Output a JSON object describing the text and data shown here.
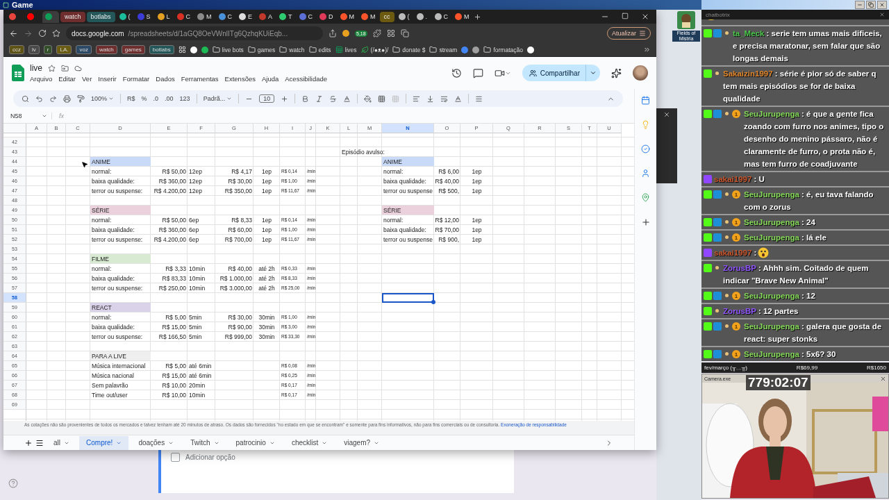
{
  "window": {
    "title": "Game"
  },
  "desktop_icon": {
    "label": "Fields of Mistria"
  },
  "browser": {
    "tabs": [
      {
        "kind": "icon",
        "color": "#e8453c",
        "selected": false
      },
      {
        "kind": "icon",
        "color": "#ff0000",
        "selected": false
      },
      {
        "kind": "icon",
        "color": "#0f9d58",
        "selected": true
      },
      {
        "kind": "group",
        "label": "watch",
        "color": "#6e2e2e",
        "selected": false
      },
      {
        "kind": "group",
        "label": "botlabs",
        "color": "#24575a",
        "selected": false
      },
      {
        "kind": "tab",
        "label": "(",
        "color": "#1abc9c",
        "selected": false
      },
      {
        "kind": "tab",
        "label": "S",
        "color": "#3b3bd8",
        "selected": false
      },
      {
        "kind": "tab",
        "label": "L",
        "color": "#e3a021",
        "selected": false
      },
      {
        "kind": "tab",
        "label": "C",
        "color": "#d93025",
        "selected": false
      },
      {
        "kind": "tab",
        "label": "M",
        "color": "#8a8a8a",
        "selected": false
      },
      {
        "kind": "tab",
        "label": "C",
        "color": "#4a90d9",
        "selected": false
      },
      {
        "kind": "tab",
        "label": "E",
        "color": "#dddddd",
        "selected": false
      },
      {
        "kind": "tab",
        "label": "A",
        "color": "#c0392b",
        "selected": false
      },
      {
        "kind": "tab",
        "label": "T",
        "color": "#2ecc71",
        "selected": false
      },
      {
        "kind": "tab",
        "label": "C",
        "color": "#5b6fd6",
        "selected": false
      },
      {
        "kind": "tab",
        "label": "D",
        "color": "#e03a5a",
        "selected": false
      },
      {
        "kind": "tab",
        "label": "M",
        "color": "#fb542b",
        "selected": false
      },
      {
        "kind": "tab",
        "label": "M",
        "color": "#fb542b",
        "selected": false
      },
      {
        "kind": "group",
        "label": "cc",
        "color": "#6b5a10",
        "selected": false
      },
      {
        "kind": "tab",
        "label": "(",
        "color": "#bbbbbb",
        "selected": false
      },
      {
        "kind": "tab",
        "label": ".",
        "color": "#bbbbbb",
        "selected": false
      },
      {
        "kind": "tab",
        "label": "C",
        "color": "#bbbbbb",
        "selected": false
      },
      {
        "kind": "tab",
        "label": "M",
        "color": "#fb542b",
        "selected": false
      }
    ],
    "url_host": "docs.google.com",
    "url_path": "/spreadsheets/d/1aGQ8OeVWnlITg6QzhqKUiEqb...",
    "extension_badge": "5,18",
    "update_button": "Atualizar",
    "bookmarks": [
      {
        "kind": "chip",
        "label": "ccz",
        "color": "#5e5214"
      },
      {
        "kind": "chip",
        "label": "lv",
        "color": "#4a4a4a"
      },
      {
        "kind": "chip",
        "label": "r",
        "color": "#34502a"
      },
      {
        "kind": "chip",
        "label": "LA.",
        "color": "#6a5c12"
      },
      {
        "kind": "chip",
        "label": "voz",
        "color": "#2c4a66"
      },
      {
        "kind": "chip",
        "label": "watch",
        "color": "#6e2e2e"
      },
      {
        "kind": "chip",
        "label": "games",
        "color": "#6e2e2e"
      },
      {
        "kind": "chip",
        "label": "botlabs",
        "color": "#24575a"
      },
      {
        "kind": "apps"
      },
      {
        "kind": "icon",
        "color": "#ffffff"
      },
      {
        "kind": "icon",
        "color": "#1db954"
      },
      {
        "kind": "folder",
        "label": "live bots"
      },
      {
        "kind": "folder",
        "label": "games"
      },
      {
        "kind": "folder",
        "label": "watch"
      },
      {
        "kind": "folder",
        "label": "edits"
      },
      {
        "kind": "sheet",
        "label": "lives"
      },
      {
        "kind": "leaf",
        "label": "(/●ᴥ●)/"
      },
      {
        "kind": "folder",
        "label": "donate $"
      },
      {
        "kind": "folder",
        "label": "stream"
      },
      {
        "kind": "icon",
        "color": "#4285f4"
      },
      {
        "kind": "icon",
        "color": "#9e9e9e"
      },
      {
        "kind": "folder",
        "label": "formatação"
      },
      {
        "kind": "icon",
        "color": "#ffffff"
      }
    ]
  },
  "sheets": {
    "title": "live",
    "menu": [
      "Arquivo",
      "Editar",
      "Ver",
      "Inserir",
      "Formatar",
      "Dados",
      "Ferramentas",
      "Extensões",
      "Ajuda",
      "Acessibilidade"
    ],
    "share_button": "Compartilhar",
    "toolbar": {
      "zoom": "100%",
      "currency": "R$",
      "percent": "%",
      "decrease_decimals": ".0",
      "increase_decimals": ".00",
      "number_format": "123",
      "font": "Padrã...",
      "font_size": "10"
    },
    "name_box": "N58",
    "formula_label": "fx",
    "columns": [
      {
        "letter": "A",
        "selected": false
      },
      {
        "letter": "B",
        "selected": false
      },
      {
        "letter": "C",
        "selected": false
      },
      {
        "letter": "D",
        "selected": false
      },
      {
        "letter": "E",
        "selected": false
      },
      {
        "letter": "F",
        "selected": false
      },
      {
        "letter": "G",
        "selected": false
      },
      {
        "letter": "H",
        "selected": false
      },
      {
        "letter": "I",
        "selected": false
      },
      {
        "letter": "J",
        "selected": false
      },
      {
        "letter": "K",
        "selected": false
      },
      {
        "letter": "L",
        "selected": false
      },
      {
        "letter": "M",
        "selected": false
      },
      {
        "letter": "N",
        "selected": true
      },
      {
        "letter": "O",
        "selected": false
      },
      {
        "letter": "P",
        "selected": false
      },
      {
        "letter": "Q",
        "selected": false
      },
      {
        "letter": "R",
        "selected": false
      },
      {
        "letter": "S",
        "selected": false
      },
      {
        "letter": "T",
        "selected": false
      },
      {
        "letter": "U",
        "selected": false
      }
    ],
    "rows": [
      {
        "number": "42",
        "selected": false
      },
      {
        "number": "43",
        "selected": false,
        "note": "Episódio avulso:"
      },
      {
        "number": "44",
        "selected": false,
        "left": {
          "kind": "header",
          "text": "ANIME",
          "color": "#c9daf8"
        },
        "right": {
          "kind": "header",
          "text": "ANIME",
          "color": "#c9daf8"
        }
      },
      {
        "number": "45",
        "selected": false,
        "left": {
          "kind": "item",
          "label": "normal:",
          "price": "R$ 50,00",
          "unit": "12ep",
          "price2": "R$ 4,17",
          "unit2": "1ep",
          "rate": "R$ 0,14",
          "per": "/min"
        },
        "right": {
          "kind": "item",
          "label": "normal:",
          "price": "R$ 6,00",
          "unit": "1ep"
        }
      },
      {
        "number": "46",
        "selected": false,
        "left": {
          "kind": "item",
          "label": "baixa qualidade:",
          "price": "R$ 360,00",
          "unit": "12ep",
          "price2": "R$ 30,00",
          "unit2": "1ep",
          "rate": "R$ 1,00",
          "per": "/min"
        },
        "right": {
          "kind": "item",
          "label": "baixa qualidade:",
          "price": "R$ 40,00",
          "unit": "1ep"
        }
      },
      {
        "number": "47",
        "selected": false,
        "left": {
          "kind": "item",
          "label": "terror ou suspense:",
          "price": "R$ 4.200,00",
          "unit": "12ep",
          "price2": "R$ 350,00",
          "unit2": "1ep",
          "rate": "R$ 11,67",
          "per": "/min"
        },
        "right": {
          "kind": "item",
          "label": "terror ou suspense",
          "price": "R$ 500,",
          "unit": "1ep"
        }
      },
      {
        "number": "48",
        "selected": false
      },
      {
        "number": "49",
        "selected": false,
        "left": {
          "kind": "header",
          "text": "SÉRIE",
          "color": "#ead1dc"
        },
        "right": {
          "kind": "header",
          "text": "SÉRIE",
          "color": "#ead1dc"
        }
      },
      {
        "number": "50",
        "selected": false,
        "left": {
          "kind": "item",
          "label": "normal:",
          "price": "R$ 50,00",
          "unit": "6ep",
          "price2": "R$ 8,33",
          "unit2": "1ep",
          "rate": "R$ 0,14",
          "per": "/min"
        },
        "right": {
          "kind": "item",
          "label": "normal:",
          "price": "R$ 12,00",
          "unit": "1ep"
        }
      },
      {
        "number": "51",
        "selected": false,
        "left": {
          "kind": "item",
          "label": "baixa qualidade:",
          "price": "R$ 360,00",
          "unit": "6ep",
          "price2": "R$ 60,00",
          "unit2": "1ep",
          "rate": "R$ 1,00",
          "per": "/min"
        },
        "right": {
          "kind": "item",
          "label": "baixa qualidade:",
          "price": "R$ 70,00",
          "unit": "1ep"
        }
      },
      {
        "number": "52",
        "selected": false,
        "left": {
          "kind": "item",
          "label": "terror ou suspense:",
          "price": "R$ 4.200,00",
          "unit": "6ep",
          "price2": "R$ 700,00",
          "unit2": "1ep",
          "rate": "R$ 11,67",
          "per": "/min"
        },
        "right": {
          "kind": "item",
          "label": "terror ou suspense",
          "price": "R$ 900,",
          "unit": "1ep"
        }
      },
      {
        "number": "53",
        "selected": false
      },
      {
        "number": "54",
        "selected": false,
        "left": {
          "kind": "header",
          "text": "FILME",
          "color": "#d9ead3"
        }
      },
      {
        "number": "55",
        "selected": false,
        "left": {
          "kind": "item",
          "label": "normal:",
          "price": "R$ 3,33",
          "unit": "10min",
          "price2": "R$ 40,00",
          "unit2": "até 2h",
          "rate": "R$ 0,33",
          "per": "/min"
        }
      },
      {
        "number": "56",
        "selected": false,
        "left": {
          "kind": "item",
          "label": "baixa qualidade:",
          "price": "R$ 83,33",
          "unit": "10min",
          "price2": "R$ 1.000,00",
          "unit2": "até 2h",
          "rate": "R$ 8,33",
          "per": "/min"
        }
      },
      {
        "number": "57",
        "selected": false,
        "left": {
          "kind": "item",
          "label": "terror ou suspense:",
          "price": "R$ 250,00",
          "unit": "10min",
          "price2": "R$ 3.000,00",
          "unit2": "até 2h",
          "rate": "R$ 25,00",
          "per": "/min"
        }
      },
      {
        "number": "58",
        "selected": true
      },
      {
        "number": "59",
        "selected": false,
        "left": {
          "kind": "header",
          "text": "REACT",
          "color": "#d9d2e9"
        }
      },
      {
        "number": "60",
        "selected": false,
        "left": {
          "kind": "item",
          "label": "normal:",
          "price": "R$ 5,00",
          "unit": "5min",
          "price2": "R$ 30,00",
          "unit2": "30min",
          "rate": "R$ 1,00",
          "per": "/min"
        }
      },
      {
        "number": "61",
        "selected": false,
        "left": {
          "kind": "item",
          "label": "baixa qualidade:",
          "price": "R$ 15,00",
          "unit": "5min",
          "price2": "R$ 90,00",
          "unit2": "30min",
          "rate": "R$ 3,00",
          "per": "/min"
        }
      },
      {
        "number": "62",
        "selected": false,
        "left": {
          "kind": "item",
          "label": "terror ou suspense:",
          "price": "R$ 166,50",
          "unit": "5min",
          "price2": "R$ 999,00",
          "unit2": "30min",
          "rate": "R$ 33,30",
          "per": "/min"
        }
      },
      {
        "number": "63",
        "selected": false
      },
      {
        "number": "64",
        "selected": false,
        "left": {
          "kind": "header",
          "text": "PARA A LIVE",
          "color": "#efefef"
        }
      },
      {
        "number": "65",
        "selected": false,
        "left": {
          "kind": "item",
          "label": "Música internacional",
          "price": "R$ 5,00",
          "unit": "até 6min",
          "rate": "R$ 0,08",
          "per": "/min"
        }
      },
      {
        "number": "66",
        "selected": false,
        "left": {
          "kind": "item",
          "label": "Música nacional",
          "price": "R$ 15,00",
          "unit": "até 6min",
          "rate": "R$ 0,25",
          "per": "/min"
        }
      },
      {
        "number": "67",
        "selected": false,
        "left": {
          "kind": "item",
          "label": "Sem palavrão",
          "price": "R$ 10,00",
          "unit": "20min",
          "rate": "R$ 0,17",
          "per": "/min"
        }
      },
      {
        "number": "68",
        "selected": false,
        "left": {
          "kind": "item",
          "label": "Time out/user",
          "price": "R$ 10,00",
          "unit": "10min",
          "rate": "R$ 0,17",
          "per": "/min"
        }
      },
      {
        "number": "69",
        "selected": false
      }
    ],
    "disclaimer": "As cotações não são provenientes de todos os mercados e talvez tenham até 20 minutos de atraso. Os dados são fornecidos \"no estado em que se encontram\" e somente para fins informativos, não para fins comerciais ou de consultoria.",
    "disclaimer_link": "Exoneração de responsabilidade",
    "sheet_tabs": [
      {
        "label": "all",
        "selected": false
      },
      {
        "label": "Compre!",
        "selected": true
      },
      {
        "label": "doações",
        "selected": false
      },
      {
        "label": "Twitch",
        "selected": false
      },
      {
        "label": "patrocinio",
        "selected": false
      },
      {
        "label": "checklist",
        "selected": false
      },
      {
        "label": "viagem?",
        "selected": false
      }
    ]
  },
  "form": {
    "option": "Adicionar opção",
    "checked": false
  },
  "chat": {
    "title": "chatbotrix",
    "messages": [
      {
        "kind": "emote"
      },
      {
        "kind": "text",
        "badges": [
          {
            "kind": "kick"
          },
          {
            "kind": "tool"
          },
          {
            "kind": "dot"
          }
        ],
        "user": "ta_Meck",
        "color": "#4cc94c",
        "text": ": serie tem umas mais dificeis, e precisa maratonar, sem falar que são longas demais"
      },
      {
        "kind": "text",
        "badges": [
          {
            "kind": "kick"
          },
          {
            "kind": "dot"
          }
        ],
        "user": "Sakaizin1997",
        "color": "#e0852a",
        "text": ": série é pior só de saber q tem mais episódios se for de baixa qualidade"
      },
      {
        "kind": "text",
        "badges": [
          {
            "kind": "kick"
          },
          {
            "kind": "tool"
          },
          {
            "kind": "dot"
          },
          {
            "kind": "coin",
            "label": "1"
          }
        ],
        "user": "SeuJurupenga",
        "color": "#86d95a",
        "text": ": é que a gente fica zoando com furro nos animes, tipo o desenho do menino pássaro, não é claramente de furro, o prota não é, mas tem furro de coadjuvante"
      },
      {
        "kind": "text",
        "badges": [
          {
            "kind": "twitch"
          }
        ],
        "user": "sakai1997",
        "color": "#c8552c",
        "text": ": U"
      },
      {
        "kind": "text",
        "badges": [
          {
            "kind": "kick"
          },
          {
            "kind": "tool"
          },
          {
            "kind": "dot"
          },
          {
            "kind": "coin",
            "label": "1"
          }
        ],
        "user": "SeuJurupenga",
        "color": "#86d95a",
        "text": ": é, eu tava falando com o zorus"
      },
      {
        "kind": "text",
        "badges": [
          {
            "kind": "kick"
          },
          {
            "kind": "tool"
          },
          {
            "kind": "dot"
          },
          {
            "kind": "coin",
            "label": "1"
          }
        ],
        "user": "SeuJurupenga",
        "color": "#86d95a",
        "text": ": 24"
      },
      {
        "kind": "text",
        "badges": [
          {
            "kind": "kick"
          },
          {
            "kind": "tool"
          },
          {
            "kind": "dot"
          },
          {
            "kind": "coin",
            "label": "1"
          }
        ],
        "user": "SeuJurupenga",
        "color": "#86d95a",
        "text": ": lá ele"
      },
      {
        "kind": "emoji",
        "badges": [
          {
            "kind": "twitch"
          }
        ],
        "user": "sakai1997",
        "color": "#c8552c",
        "text": ":"
      },
      {
        "kind": "text",
        "badges": [
          {
            "kind": "kick"
          },
          {
            "kind": "dot"
          }
        ],
        "user": "ZorusBP",
        "color": "#8f55ff",
        "text": ": Ahhh sim. Coitado de quem indicar \"Brave New Animal\""
      },
      {
        "kind": "text",
        "badges": [
          {
            "kind": "kick"
          },
          {
            "kind": "tool"
          },
          {
            "kind": "dot"
          },
          {
            "kind": "coin",
            "label": "1"
          }
        ],
        "user": "SeuJurupenga",
        "color": "#86d95a",
        "text": ": 12"
      },
      {
        "kind": "text",
        "badges": [
          {
            "kind": "kick"
          },
          {
            "kind": "dot"
          }
        ],
        "user": "ZorusBP",
        "color": "#8f55ff",
        "text": ": 12 partes"
      },
      {
        "kind": "text",
        "badges": [
          {
            "kind": "kick"
          },
          {
            "kind": "tool"
          },
          {
            "kind": "dot"
          },
          {
            "kind": "coin",
            "label": "1"
          }
        ],
        "user": "SeuJurupenga",
        "color": "#86d95a",
        "text": ": galera que gosta de react: super stonks"
      },
      {
        "kind": "text",
        "badges": [
          {
            "kind": "kick"
          },
          {
            "kind": "tool"
          },
          {
            "kind": "dot"
          },
          {
            "kind": "coin",
            "label": "1"
          }
        ],
        "user": "SeuJurupenga",
        "color": "#86d95a",
        "text": ": 5x6? 30"
      }
    ]
  },
  "overlay": {
    "goal": "fev/março (╥﹏╥)",
    "raised": "R$69,99",
    "target": "R$1650",
    "timer": "779:02:07",
    "camera_title": "Camera.exe"
  }
}
